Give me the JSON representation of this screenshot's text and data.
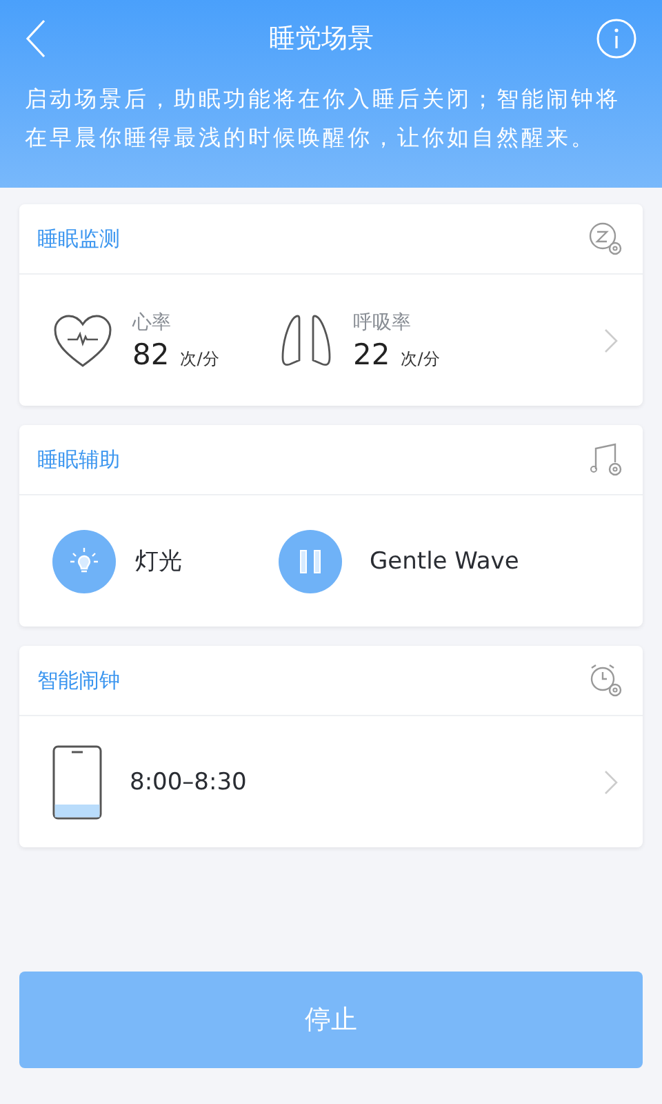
{
  "header": {
    "title": "睡觉场景",
    "description": "启动场景后，助眠功能将在你入睡后关闭；智能闹钟将在早晨你睡得最浅的时候唤醒你，让你如自然醒来。"
  },
  "cards": [
    {
      "kind": "vitals",
      "title": "睡眠监测",
      "chevron": true,
      "items": [
        {
          "kind": "heart",
          "label": "心率",
          "value": "82",
          "unit": "次/分"
        },
        {
          "kind": "lungs",
          "label": "呼吸率",
          "value": "22",
          "unit": "次/分"
        }
      ]
    },
    {
      "kind": "aids",
      "title": "睡眠辅助",
      "chevron": false,
      "items": [
        {
          "kind": "bulb",
          "label": "灯光"
        },
        {
          "kind": "pause",
          "label": "Gentle Wave"
        }
      ]
    },
    {
      "kind": "alarm",
      "title": "智能闹钟",
      "chevron": true,
      "items": [
        {
          "kind": "phone",
          "label": "8:00–8:30"
        }
      ]
    }
  ],
  "stop_button": "停止"
}
